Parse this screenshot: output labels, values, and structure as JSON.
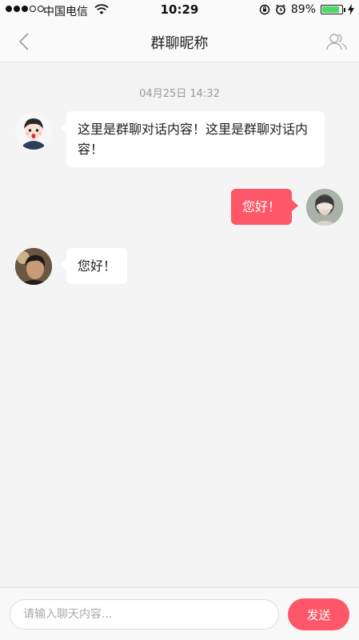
{
  "status_bar": {
    "carrier": "中国电信",
    "time": "10:29",
    "battery_text": "89%",
    "battery_level": 0.89,
    "battery_color": "#4cd964",
    "signal_bars_filled": 3,
    "signal_bars_total": 5,
    "icons": [
      "wifi-icon",
      "orientation-lock-icon",
      "alarm-icon",
      "battery-icon",
      "charging-icon"
    ]
  },
  "header": {
    "title": "群聊昵称",
    "back_icon": "chevron-left-icon",
    "members_icon": "group-members-icon"
  },
  "chat": {
    "timestamp": "04月25日 14:32",
    "messages": [
      {
        "side": "left",
        "text": "这里是群聊对话内容！这里是群聊对话内容！",
        "avatar": "cartoon-avatar"
      },
      {
        "side": "right",
        "text": "您好！",
        "avatar": "photo-avatar"
      },
      {
        "side": "left",
        "text": "您好！",
        "avatar": "photo-avatar"
      }
    ]
  },
  "input_bar": {
    "placeholder": "请输入聊天内容...",
    "value": "",
    "send_label": "发送"
  },
  "colors": {
    "accent": "#fd5769",
    "background": "#f4f4f4",
    "bubble_left": "#ffffff",
    "timestamp_text": "#9a9a9a"
  }
}
